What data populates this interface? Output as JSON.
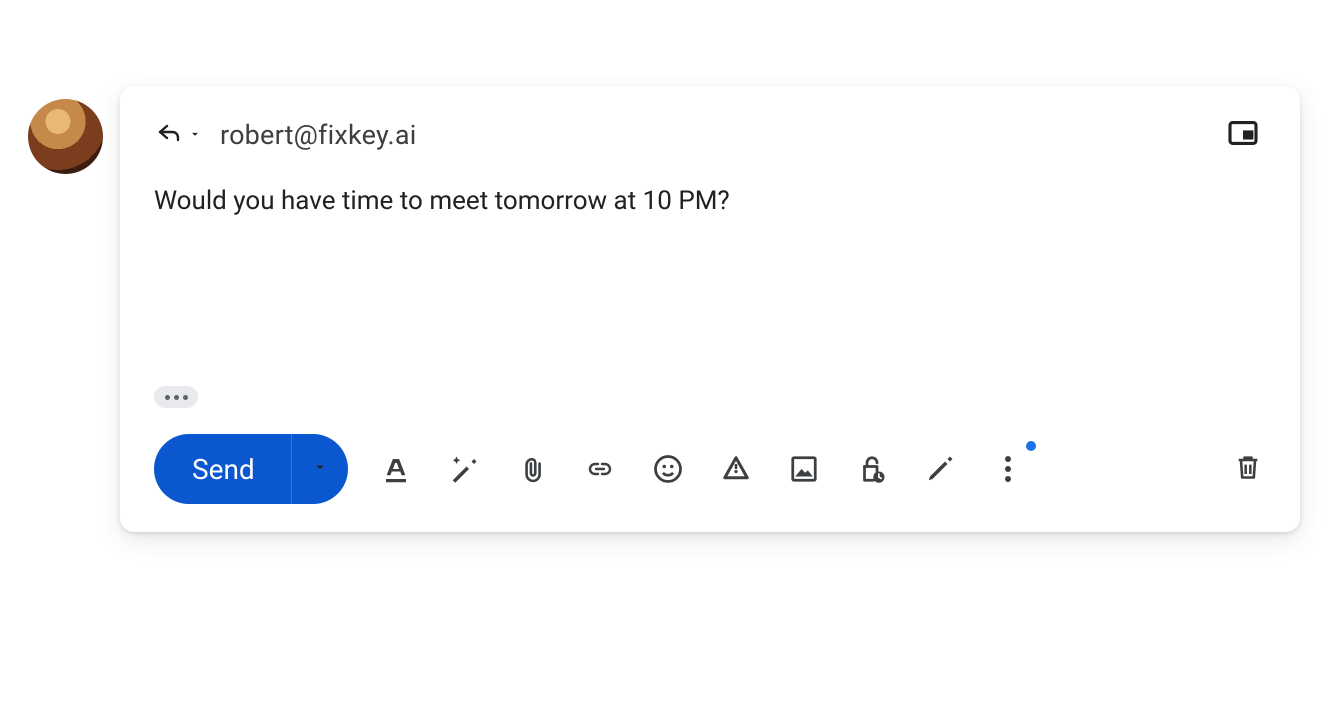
{
  "compose": {
    "recipient": "robert@fixkey.ai",
    "body": "Would you have time to meet tomorrow at 10 PM?",
    "send_label": "Send"
  },
  "icons": {
    "reply": "reply",
    "reply_dropdown": "dropdown",
    "popout": "open-in-popup",
    "formatting": "text-format",
    "ai_compose": "magic-pen",
    "attach": "attach-file",
    "link": "insert-link",
    "emoji": "emoji",
    "drive": "drive",
    "image": "insert-image",
    "confidential": "confidential-lock",
    "signature": "ink-pen",
    "more": "more-vert",
    "trash": "delete"
  },
  "colors": {
    "primary": "#0b57d0",
    "icon": "#3c4043",
    "pill": "#e8eaed"
  }
}
